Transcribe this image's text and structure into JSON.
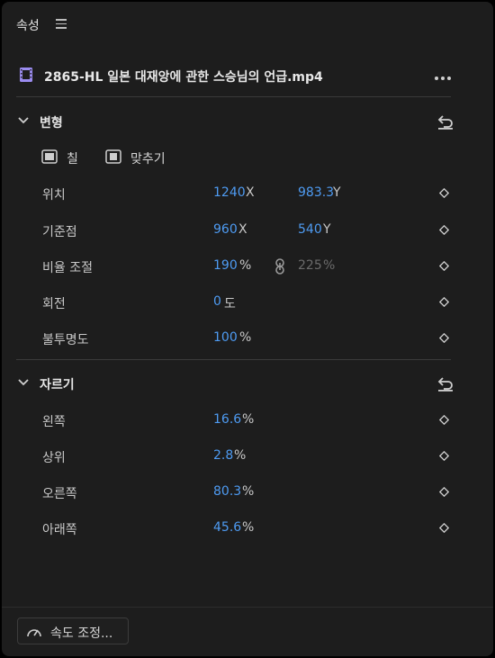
{
  "panel": {
    "title": "속성"
  },
  "clip": {
    "name": "2865-HL 일본 대재앙에 관한 스승님의 언급.mp4"
  },
  "transform": {
    "title": "변형",
    "fill_label": "칠",
    "fit_label": "맞추기",
    "position": {
      "label": "위치",
      "x": "1240",
      "x_unit": "X",
      "y": "983.3",
      "y_unit": "Y"
    },
    "anchor": {
      "label": "기준점",
      "x": "960",
      "x_unit": "X",
      "y": "540",
      "y_unit": "Y"
    },
    "scale": {
      "label": "비율 조절",
      "w": "190",
      "w_unit": "%",
      "h": "225",
      "h_unit": "%"
    },
    "rotation": {
      "label": "회전",
      "value": "0",
      "unit": "도"
    },
    "opacity": {
      "label": "불투명도",
      "value": "100",
      "unit": "%"
    }
  },
  "crop": {
    "title": "자르기",
    "left": {
      "label": "왼쪽",
      "value": "16.6",
      "unit": "%"
    },
    "top": {
      "label": "상위",
      "value": "2.8",
      "unit": "%"
    },
    "right": {
      "label": "오른쪽",
      "value": "80.3",
      "unit": "%"
    },
    "bottom": {
      "label": "아래쪽",
      "value": "45.6",
      "unit": "%"
    }
  },
  "footer": {
    "speed_label": "속도 조정..."
  },
  "colors": {
    "accent": "#4e9bf2",
    "background": "#1d1d1d",
    "clip_icon": "#9b8cf0"
  }
}
